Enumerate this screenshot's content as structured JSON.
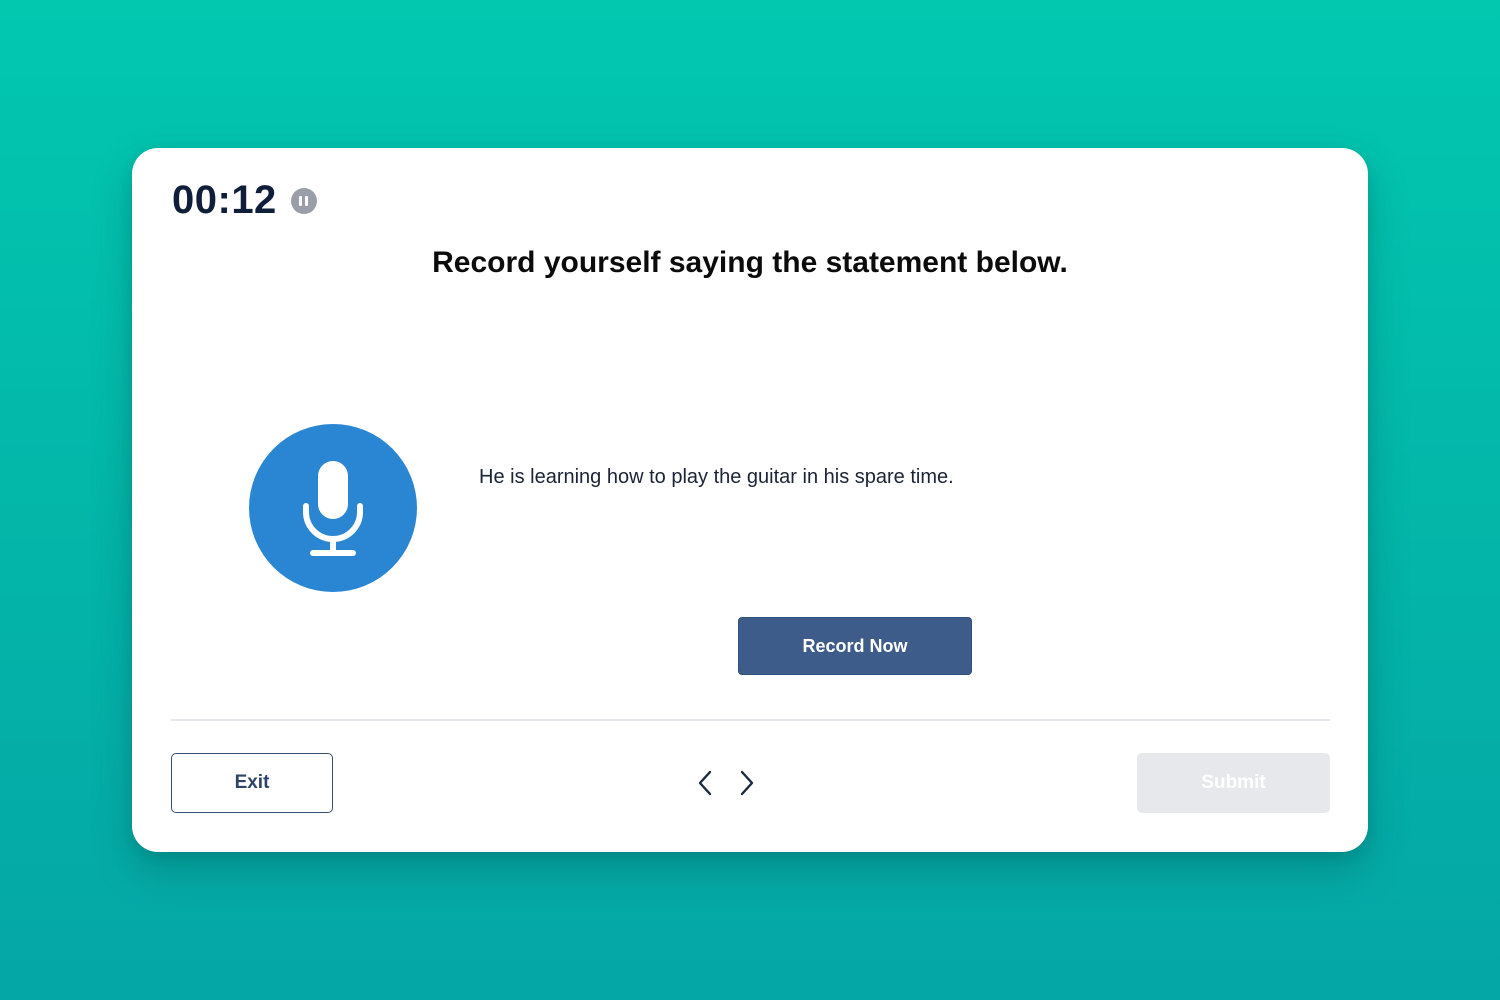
{
  "timer": {
    "value": "00:12",
    "pause_icon": "pause-icon"
  },
  "prompt": {
    "title": "Record yourself saying the statement below.",
    "statement": "He is learning how to play the guitar in his spare time.",
    "mic_icon": "microphone-icon",
    "record_label": "Record Now"
  },
  "footer": {
    "exit_label": "Exit",
    "prev_icon": "chevron-left-icon",
    "next_icon": "chevron-right-icon",
    "submit_label": "Submit",
    "submit_disabled": true
  },
  "colors": {
    "background_top": "#02c8b0",
    "background_bottom": "#05a6a6",
    "mic_circle": "#2a86d3",
    "record_button": "#3e5c8a",
    "timer_text": "#0f1f3a",
    "submit_disabled_bg": "#e6e8ec"
  }
}
